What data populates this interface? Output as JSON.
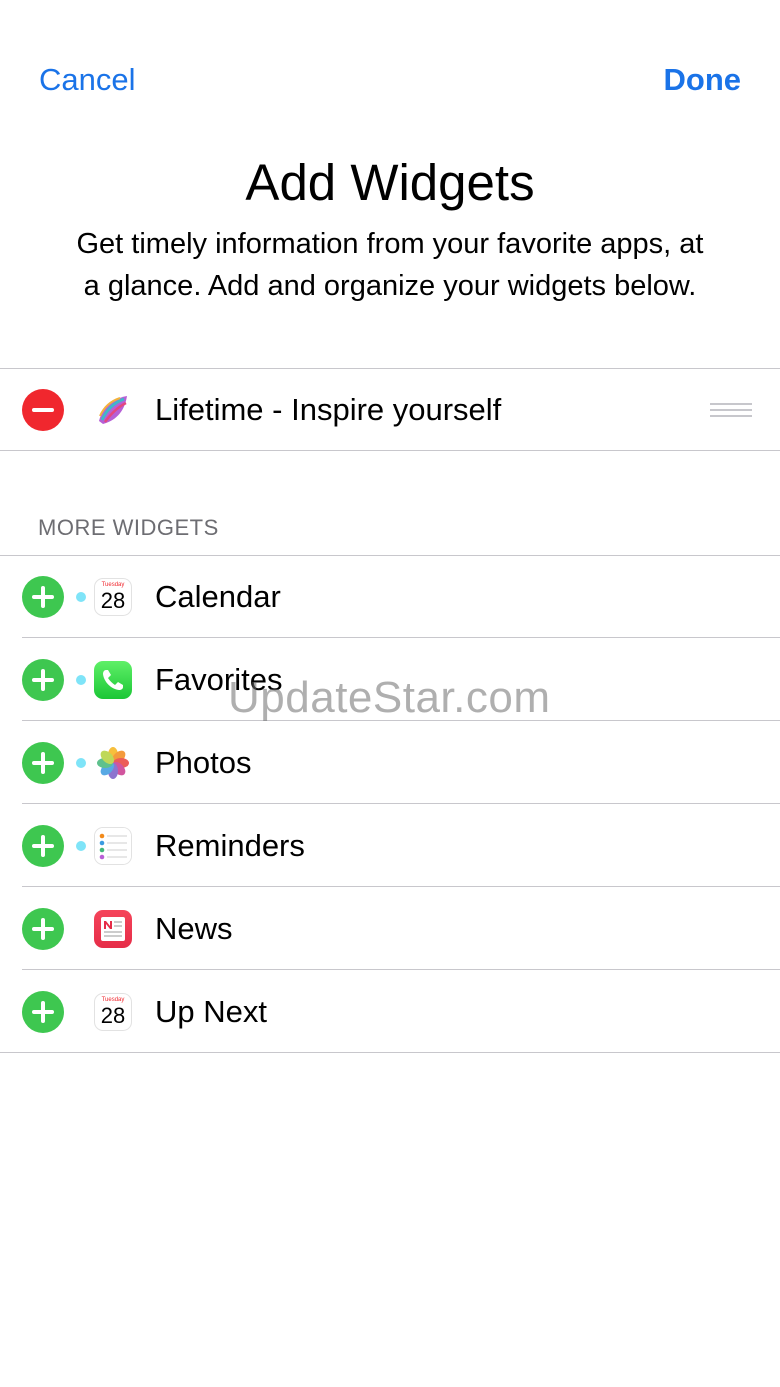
{
  "nav": {
    "cancel_label": "Cancel",
    "done_label": "Done"
  },
  "header": {
    "title": "Add Widgets",
    "subtitle": "Get timely information from your favorite apps, at a glance. Add and organize your widgets below."
  },
  "active_widgets": [
    {
      "label": "Lifetime - Inspire yourself",
      "icon": "lifetime-app-icon"
    }
  ],
  "more_widgets": {
    "header": "MORE WIDGETS",
    "items": [
      {
        "label": "Calendar",
        "icon": "calendar-app-icon",
        "calendar_day": "Tuesday",
        "calendar_date": "28"
      },
      {
        "label": "Favorites",
        "icon": "phone-app-icon"
      },
      {
        "label": "Photos",
        "icon": "photos-app-icon"
      },
      {
        "label": "Reminders",
        "icon": "reminders-app-icon"
      },
      {
        "label": "News",
        "icon": "news-app-icon"
      },
      {
        "label": "Up Next",
        "icon": "calendar-app-icon",
        "calendar_day": "Tuesday",
        "calendar_date": "28"
      }
    ]
  },
  "watermark": "UpdateStar.com",
  "colors": {
    "accent": "#1a73e8",
    "add": "#3ec750",
    "remove": "#f0272e",
    "new_dot": "#7fe4f8"
  }
}
